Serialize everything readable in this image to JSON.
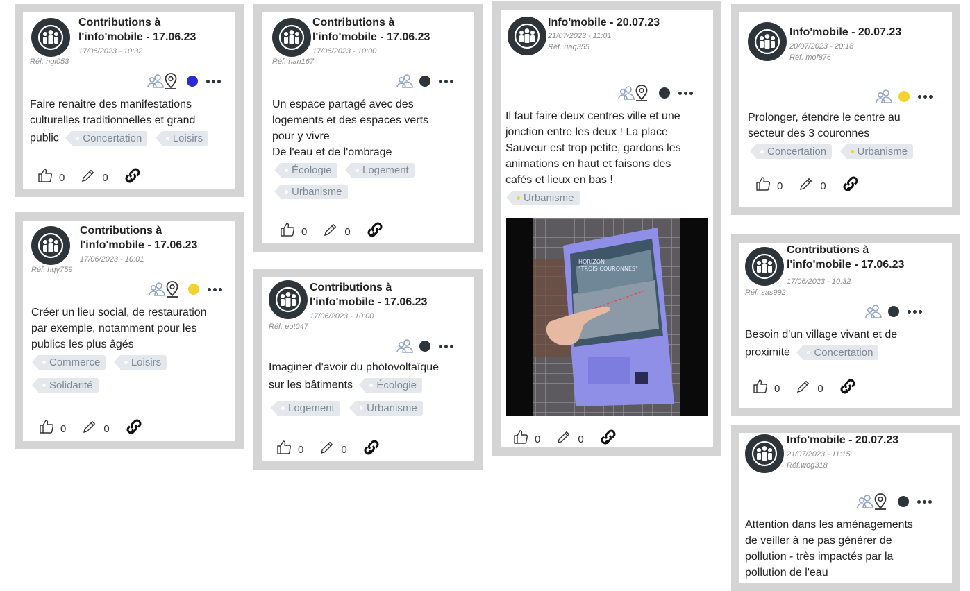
{
  "colors": {
    "border": "#d4d4d4",
    "avatar_bg": "#2e353a",
    "tag_bg": "#e4e8ec",
    "tag_text": "#7d8a96",
    "status_blue": "#2b2bd6",
    "status_yellow": "#f2d22e",
    "status_dark": "#2e353a"
  },
  "icons": {
    "avatar": "group-people-icon",
    "group": "people-search-icon",
    "pin": "map-pin-icon",
    "more": "more-dots-icon",
    "like": "thumbs-up-icon",
    "edit": "pencil-icon",
    "link": "link-add-icon"
  },
  "cards": [
    {
      "title": "Contributions à\nl'info'mobile - 17.06.23",
      "title_l1": "Contributions à",
      "title_l2": "l'info'mobile - 17.06.23",
      "date": "17/06/2023 - 10:32",
      "ref": "Réf. ngi053",
      "status": "blue",
      "body": [
        "Faire renaitre des manifestations",
        "culturelles traditionnelles et grand",
        "public"
      ],
      "tags": [
        "Concertation",
        "Loisirs"
      ],
      "likes": "0",
      "edits": "0"
    },
    {
      "title_l1": "Contributions à",
      "title_l2": "l'info'mobile - 17.06.23",
      "date": "17/06/2023 - 10:01",
      "ref": "Réf. hqy759",
      "status": "yellow",
      "body": [
        "Créer un lieu social, de restauration",
        "par exemple, notamment pour les",
        "publics les plus âgés"
      ],
      "tags": [
        "Commerce",
        "Loisirs",
        "Solidarité"
      ],
      "likes": "0",
      "edits": "0"
    },
    {
      "title_l1": "Contributions à",
      "title_l2": "l'info'mobile - 17.06.23",
      "date": "17/06/2023 - 10:00",
      "ref": "Réf. nan167",
      "status": "dark",
      "body": [
        "Un espace partagé avec des",
        "logements et des espaces verts",
        "pour y vivre",
        "De l'eau et de l'ombrage"
      ],
      "tags": [
        "Écologie",
        "Logement",
        "Urbanisme"
      ],
      "likes": "0",
      "edits": "0"
    },
    {
      "title_l1": "Contributions à",
      "title_l2": "l'info'mobile - 17.06.23",
      "date": "17/06/2023 - 10:00",
      "ref": "Réf. eot047",
      "status": "dark",
      "body": [
        "Imaginer d'avoir du photovoltaïque",
        "sur les bâtiments"
      ],
      "tags": [
        "Écologie",
        "Logement",
        "Urbanisme"
      ],
      "likes": "0",
      "edits": "0"
    },
    {
      "title_l1": "Info'mobile - 20.07.23",
      "date": "21/07/2023 - 11:01",
      "ref": "Réf. uaq355",
      "status": "dark",
      "body": [
        "Il faut faire deux centres ville et une",
        "jonction entre les deux ! La place",
        "Sauveur est trop petite, gardons les",
        "animations en haut et faisons des",
        "cafés et lieux en bas !"
      ],
      "tags": [
        "Urbanisme"
      ],
      "photo_caption_1": "HORIZON",
      "photo_caption_2": "\"TROIS COURONNES\"",
      "likes": "0",
      "edits": "0"
    },
    {
      "title_l1": "Info'mobile - 20.07.23",
      "date": "20/07/2023 - 20:18",
      "ref": "Réf. mof876",
      "status": "yellow",
      "body": [
        "Prolonger, étendre le centre au",
        "secteur des 3 couronnes"
      ],
      "tags": [
        "Concertation",
        "Urbanisme"
      ],
      "likes": "0",
      "edits": "0"
    },
    {
      "title_l1": "Contributions à",
      "title_l2": "l'info'mobile - 17.06.23",
      "date": "17/06/2023 - 10:32",
      "ref": "Réf. sas992",
      "status": "dark",
      "body": [
        "Besoin d'un village vivant et de",
        "proximité"
      ],
      "tags": [
        "Concertation"
      ],
      "likes": "0",
      "edits": "0"
    },
    {
      "title_l1": "Info'mobile - 20.07.23",
      "date": "21/07/2023 - 11:15",
      "ref": "Réf.wog318",
      "status": "dark",
      "body": [
        "Attention dans les aménagements",
        "de veiller à ne pas générer de",
        "pollution - très impactés par la",
        "pollution de l'eau"
      ],
      "tags": [],
      "likes": "",
      "edits": ""
    }
  ]
}
